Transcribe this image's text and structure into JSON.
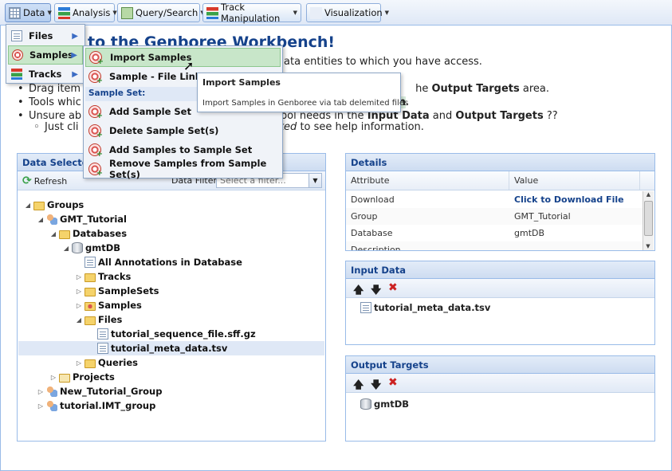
{
  "toolbar": {
    "data_label": "Data",
    "analysis_label": "Analysis",
    "query_label": "Query/Search",
    "track_label": "Track Manipulation",
    "viz_label": "Visualization"
  },
  "welcome": {
    "heading": "to the Genboree Workbench!",
    "line1": "ata entities to which you have access.",
    "line2a": "Drag item",
    "line2b": "he",
    "line2c": "Output Targets",
    "line2d": "area.",
    "line3a": "Tools whic",
    "line3b": "n",
    "line3c": ".",
    "line4a": "Unsure ab",
    "line4b": "ool needs in the",
    "line4c": "Input Data",
    "line4d": "and",
    "line4e": "Output Targets",
    "line4f": "??",
    "line5a": "Just cli",
    "line5b": "ghted",
    "line5c": "to see help information."
  },
  "data_menu": {
    "items": [
      {
        "label": "Files"
      },
      {
        "label": "Samples"
      },
      {
        "label": "Tracks"
      }
    ]
  },
  "samples_menu": {
    "import_samples": "Import Samples",
    "sample_file_linker": "Sample - File Linker",
    "sample_set_header": "Sample Set:",
    "add_sample_set": "Add Sample Set",
    "delete_sample_set": "Delete Sample Set(s)",
    "add_samples_to_set": "Add Samples to Sample Set",
    "remove_samples_from_set": "Remove Samples from Sample Set(s)"
  },
  "tooltip": {
    "title": "Import Samples",
    "body": "Import Samples in Genboree via tab delemited files"
  },
  "data_selector": {
    "title": "Data Selector",
    "refresh": "Refresh",
    "filter_label": "Data Filter:",
    "filter_placeholder": "Select a filter...",
    "tree": [
      {
        "label": "Groups"
      },
      {
        "label": "GMT_Tutorial"
      },
      {
        "label": "Databases"
      },
      {
        "label": "gmtDB"
      },
      {
        "label": "All Annotations in Database"
      },
      {
        "label": "Tracks"
      },
      {
        "label": "SampleSets"
      },
      {
        "label": "Samples"
      },
      {
        "label": "Files"
      },
      {
        "label": "tutorial_sequence_file.sff.gz"
      },
      {
        "label": "tutorial_meta_data.tsv"
      },
      {
        "label": "Queries"
      },
      {
        "label": "Projects"
      },
      {
        "label": "New_Tutorial_Group"
      },
      {
        "label": "tutorial.IMT_group"
      }
    ]
  },
  "details": {
    "title": "Details",
    "col_attribute": "Attribute",
    "col_value": "Value",
    "rows": [
      {
        "attr": "Download",
        "value": "Click to Download File"
      },
      {
        "attr": "Group",
        "value": "GMT_Tutorial"
      },
      {
        "attr": "Database",
        "value": "gmtDB"
      },
      {
        "attr": "Description",
        "value": ""
      }
    ]
  },
  "input_data": {
    "title": "Input Data",
    "item": "tutorial_meta_data.tsv"
  },
  "output_targets": {
    "title": "Output Targets",
    "item": "gmtDB"
  },
  "colors": {
    "header_blue": "#15428b",
    "border_blue": "#99bbe8",
    "menu_hover_green": "#c8e6c9",
    "remove_red": "#cc2222"
  }
}
